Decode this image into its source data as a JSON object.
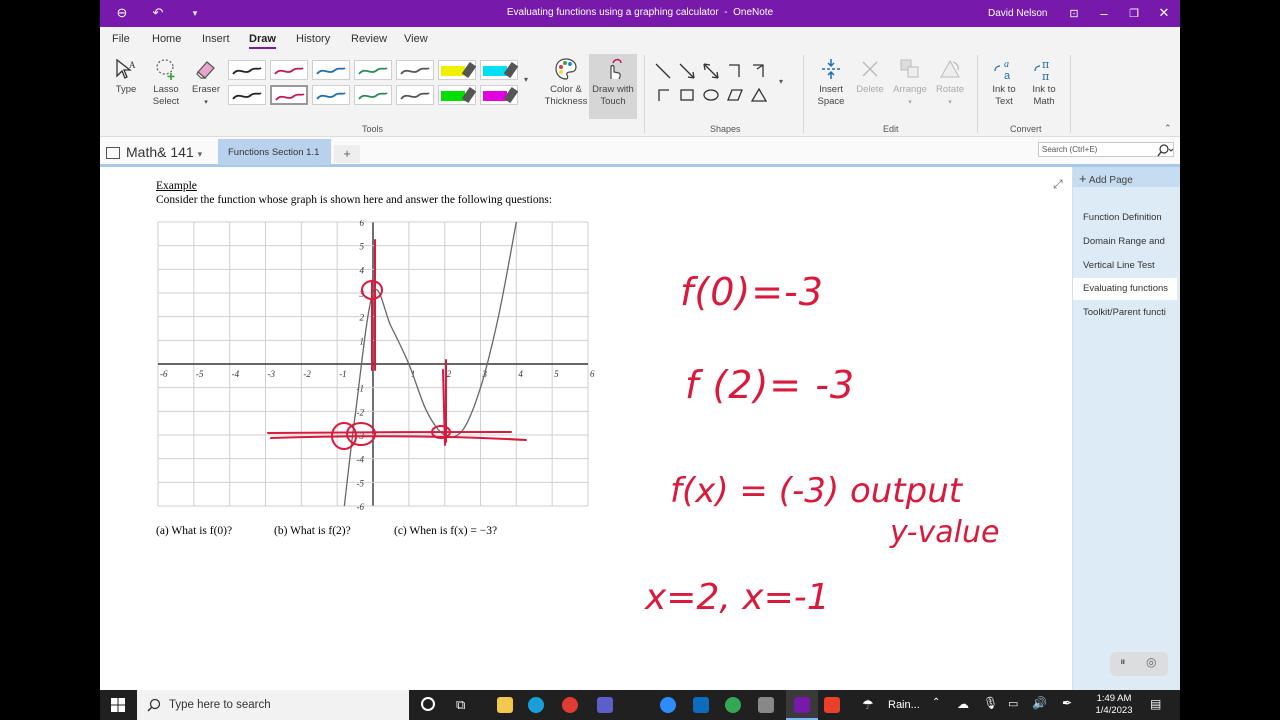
{
  "window": {
    "title": "Evaluating functions using a graphing calculator",
    "app_name": "OneNote",
    "user": "David Nelson",
    "title_sep": "-"
  },
  "ribbon_tabs": [
    "File",
    "Home",
    "Insert",
    "Draw",
    "History",
    "Review",
    "View"
  ],
  "ribbon_active_tab": "Draw",
  "tools": {
    "type_label": "Type",
    "lasso_label": "Lasso",
    "lasso_label2": "Select",
    "eraser_label": "Eraser",
    "color_thickness": "Color &",
    "color_thickness2": "Thickness",
    "draw_touch": "Draw with",
    "draw_touch2": "Touch",
    "group_label": "Tools"
  },
  "shapes_group": {
    "label": "Shapes"
  },
  "edit_group": {
    "insert_space": "Insert",
    "insert_space2": "Space",
    "delete": "Delete",
    "arrange": "Arrange",
    "rotate": "Rotate",
    "label": "Edit"
  },
  "convert_group": {
    "ink_text": "Ink to",
    "ink_text2": "Text",
    "ink_math": "Ink to",
    "ink_math2": "Math",
    "label": "Convert"
  },
  "pen_colors": [
    "#222222",
    "#c2185b",
    "#1f6fb2",
    "#2e8b57",
    "#555555",
    "#222222",
    "#c2185b",
    "#1f6fb2",
    "#2e8b57",
    "#555555"
  ],
  "highlighter_colors": [
    "#f0f000",
    "#00e0f0",
    "#00e000",
    "#e000e0"
  ],
  "notebook": {
    "name": "Math& 141",
    "section": "Functions Section 1.1",
    "add_tab": "+",
    "search_placeholder": "Search (Ctrl+E)"
  },
  "pages": {
    "add_page": "Add Page",
    "items": [
      "Function Definition",
      "Domain Range and",
      "Vertical Line Test",
      "Evaluating functions",
      "Toolkit/Parent functi"
    ],
    "selected_index": 3
  },
  "note": {
    "heading": "Example",
    "prompt": "Consider the function whose graph is shown here and answer the following questions:",
    "q_a": "(a)  What is f(0)?",
    "q_b": "(b)  What is f(2)?",
    "q_c": "(c)  When is f(x) = −3?"
  },
  "handwriting": {
    "line1": "f(0)=-3",
    "line2": "f (2)= -3",
    "line3": "f(x) = (-3) output",
    "line3b": "y-value",
    "line4": "x=2,  x=-1"
  },
  "graph": {
    "x_ticks": [
      "-6",
      "-5",
      "-4",
      "-3",
      "-2",
      "-1",
      "1",
      "2",
      "3",
      "4",
      "5",
      "6"
    ],
    "y_ticks": [
      "6",
      "5",
      "4",
      "3",
      "2",
      "1",
      "-1",
      "-2",
      "-3",
      "-4",
      "-5",
      "-6"
    ],
    "xlim": [
      -6,
      6
    ],
    "ylim": [
      -6,
      6
    ],
    "curve_points": [
      [
        -0.8,
        -6
      ],
      [
        -0.5,
        -2.2
      ],
      [
        0,
        3
      ],
      [
        0.5,
        1.6
      ],
      [
        1,
        0
      ],
      [
        1.5,
        -2
      ],
      [
        2,
        -3
      ],
      [
        2.5,
        -2.8
      ],
      [
        3,
        -1
      ],
      [
        3.5,
        2
      ],
      [
        4,
        6
      ]
    ]
  },
  "taskbar": {
    "search_placeholder": "Type here to search",
    "weather": "Rain...",
    "time": "1:49 AM",
    "date": "1/4/2023"
  }
}
